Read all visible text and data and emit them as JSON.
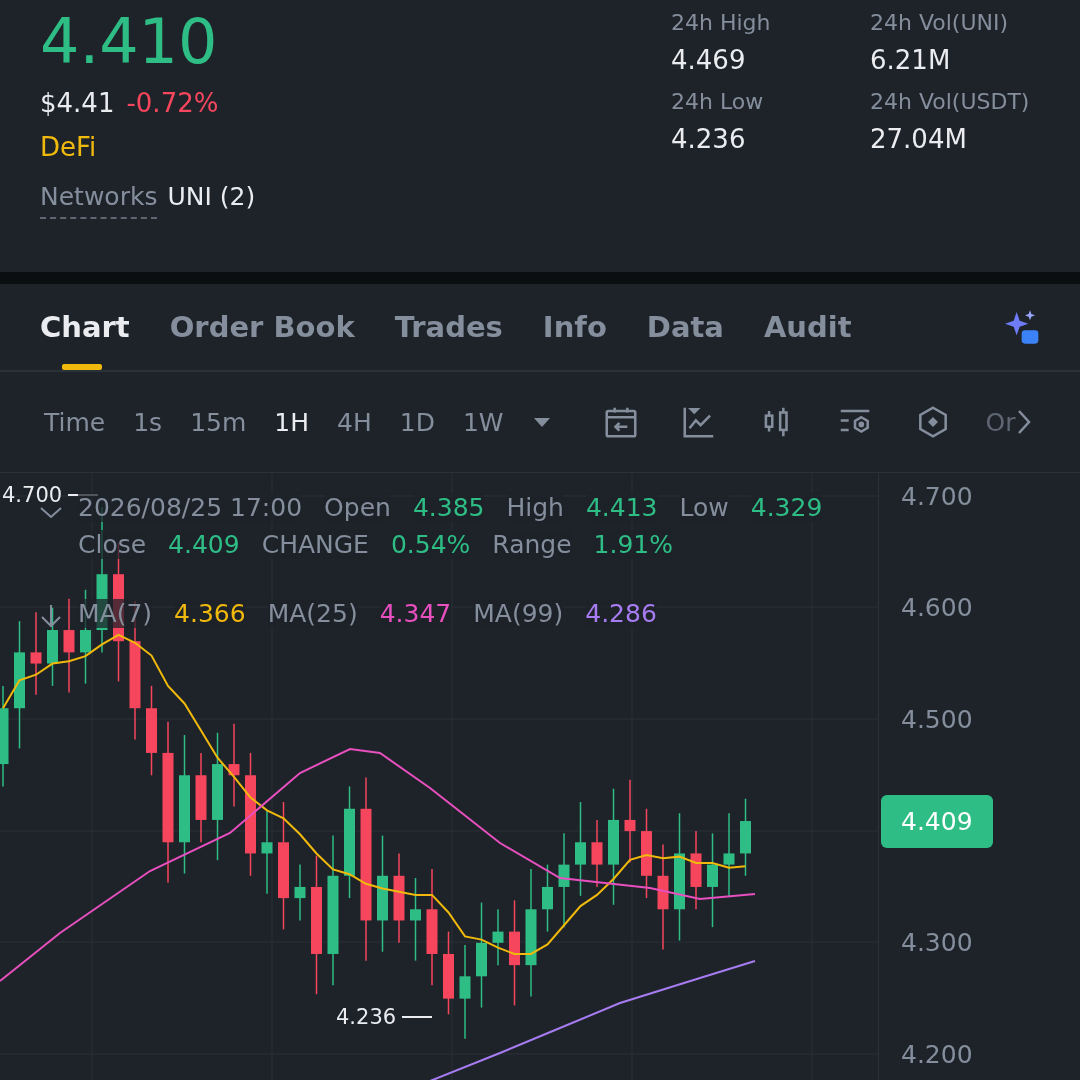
{
  "header": {
    "price": "4.410",
    "fiat_price": "$4.41",
    "change": "-0.72%",
    "category": "DeFi",
    "networks_label": "Networks",
    "networks_value": "UNI (2)"
  },
  "stats": [
    {
      "label": "24h High",
      "value": "4.469"
    },
    {
      "label": "24h Vol(UNI)",
      "value": "6.21M"
    },
    {
      "label": "24h Low",
      "value": "4.236"
    },
    {
      "label": "24h Vol(USDT)",
      "value": "27.04M"
    }
  ],
  "tabs": [
    {
      "label": "Chart",
      "selected": true
    },
    {
      "label": "Order Book",
      "selected": false
    },
    {
      "label": "Trades",
      "selected": false
    },
    {
      "label": "Info",
      "selected": false
    },
    {
      "label": "Data",
      "selected": false
    },
    {
      "label": "Audit",
      "selected": false
    }
  ],
  "intervals": [
    {
      "label": "Time",
      "selected": false
    },
    {
      "label": "1s",
      "selected": false
    },
    {
      "label": "15m",
      "selected": false
    },
    {
      "label": "1H",
      "selected": true
    },
    {
      "label": "4H",
      "selected": false
    },
    {
      "label": "1D",
      "selected": false
    },
    {
      "label": "1W",
      "selected": false
    }
  ],
  "toolbar_more": "Or",
  "chart": {
    "timestamp": "2026/08/25 17:00",
    "ohlc": [
      {
        "label": "Open",
        "value": "4.385"
      },
      {
        "label": "High",
        "value": "4.413"
      },
      {
        "label": "Low",
        "value": "4.329"
      },
      {
        "label": "Close",
        "value": "4.409"
      },
      {
        "label": "CHANGE",
        "value": "0.54%"
      },
      {
        "label": "Range",
        "value": "1.91%"
      }
    ],
    "moving_averages": [
      {
        "label": "MA(7)",
        "value": "4.366",
        "color": "#f0b90b"
      },
      {
        "label": "MA(25)",
        "value": "4.347",
        "color": "#e84fbf"
      },
      {
        "label": "MA(99)",
        "value": "4.286",
        "color": "#a77cf2"
      }
    ],
    "y_axis": [
      "4.700",
      "4.600",
      "4.500",
      "4.300",
      "4.200"
    ],
    "current_price": "4.409",
    "high_marker": "4.700",
    "low_marker": "4.236"
  }
}
